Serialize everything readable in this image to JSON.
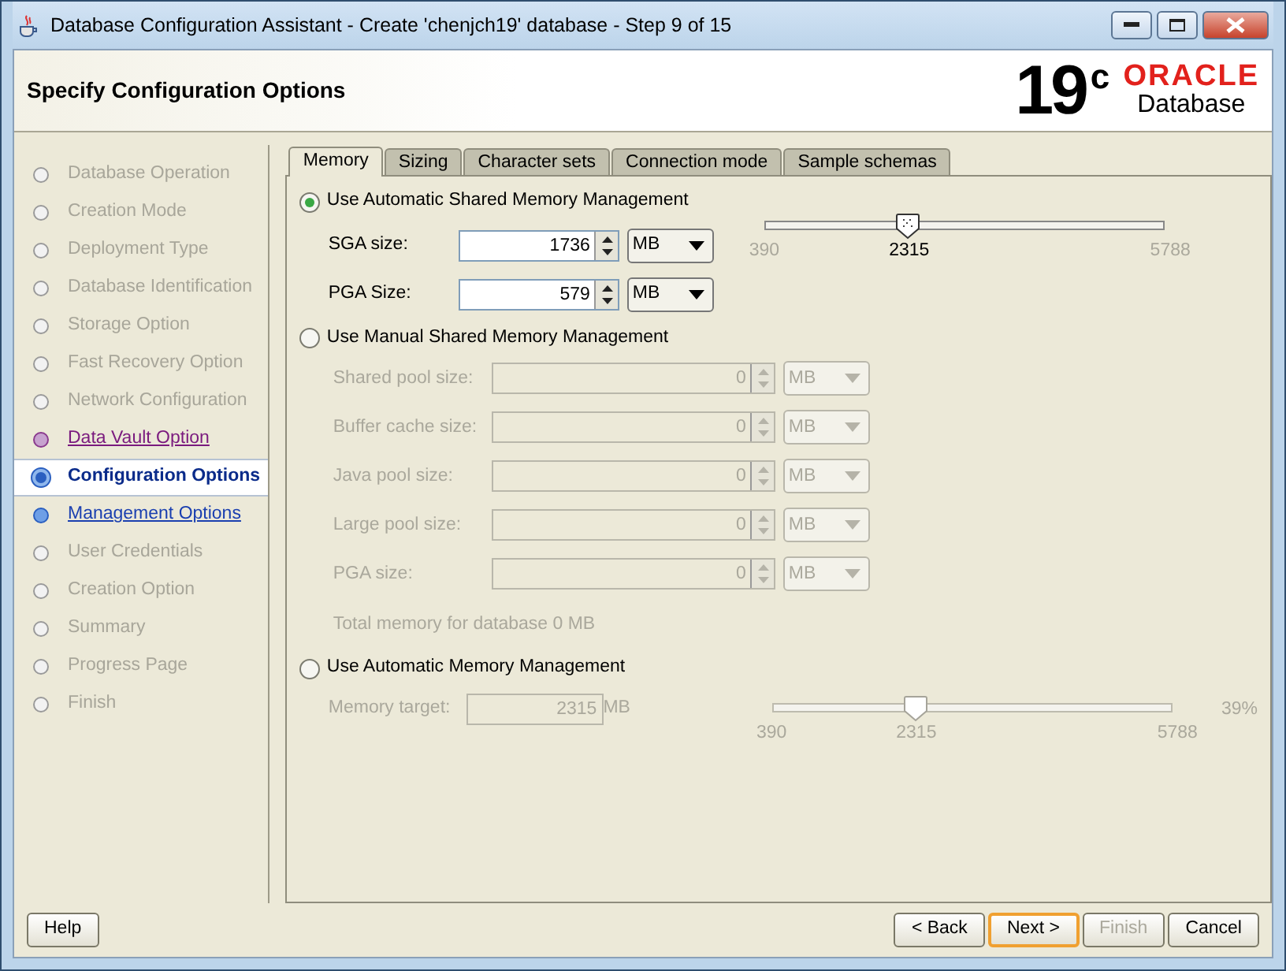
{
  "window": {
    "title": "Database Configuration Assistant - Create 'chenjch19' database - Step 9 of 15"
  },
  "header": {
    "title": "Specify Configuration Options",
    "logo_version": "19",
    "logo_superscript": "c",
    "logo_brand": "ORACLE",
    "logo_product": "Database"
  },
  "steps": [
    {
      "label": "Database Operation",
      "kind": "disabled",
      "selected": false
    },
    {
      "label": "Creation Mode",
      "kind": "disabled",
      "selected": false
    },
    {
      "label": "Deployment Type",
      "kind": "disabled",
      "selected": false
    },
    {
      "label": "Database Identification",
      "kind": "disabled",
      "selected": false
    },
    {
      "label": "Storage Option",
      "kind": "disabled",
      "selected": false
    },
    {
      "label": "Fast Recovery Option",
      "kind": "disabled",
      "selected": false
    },
    {
      "label": "Network Configuration",
      "kind": "disabled",
      "selected": false
    },
    {
      "label": "Data Vault Option",
      "kind": "visited",
      "selected": false
    },
    {
      "label": "Configuration Options",
      "kind": "current",
      "selected": true
    },
    {
      "label": "Management Options",
      "kind": "link",
      "selected": false
    },
    {
      "label": "User Credentials",
      "kind": "disabled",
      "selected": false
    },
    {
      "label": "Creation Option",
      "kind": "disabled",
      "selected": false
    },
    {
      "label": "Summary",
      "kind": "disabled",
      "selected": false
    },
    {
      "label": "Progress Page",
      "kind": "disabled",
      "selected": false
    },
    {
      "label": "Finish",
      "kind": "disabled",
      "selected": false
    }
  ],
  "tabs": [
    {
      "label": "Memory",
      "selected": true
    },
    {
      "label": "Sizing",
      "selected": false
    },
    {
      "label": "Character sets",
      "selected": false
    },
    {
      "label": "Connection mode",
      "selected": false
    },
    {
      "label": "Sample schemas",
      "selected": false
    }
  ],
  "memory_options": [
    {
      "label": "Use Automatic Shared Memory Management",
      "selected": true,
      "fields": [
        {
          "label": "SGA size:",
          "value": "1736",
          "unit": "MB",
          "disabled": false
        },
        {
          "label": "PGA Size:",
          "value": "579",
          "unit": "MB",
          "disabled": false
        }
      ],
      "slider": {
        "level": 0.357,
        "min": "390",
        "value": "2315",
        "max": "5788",
        "disabled": false
      }
    },
    {
      "label": "Use Manual Shared Memory Management",
      "selected": false,
      "fields": [
        {
          "label": "Shared pool size:",
          "value": "0",
          "unit": "MB",
          "disabled": true
        },
        {
          "label": "Buffer cache size:",
          "value": "0",
          "unit": "MB",
          "disabled": true
        },
        {
          "label": "Java pool size:",
          "value": "0",
          "unit": "MB",
          "disabled": true
        },
        {
          "label": "Large pool size:",
          "value": "0",
          "unit": "MB",
          "disabled": true
        },
        {
          "label": "PGA size:",
          "value": "0",
          "unit": "MB",
          "disabled": true
        }
      ],
      "note": "Total memory for database 0 MB"
    },
    {
      "label": "Use Automatic Memory Management",
      "selected": false,
      "target": {
        "label": "Memory target:",
        "value": "2315",
        "unit": "MB",
        "disabled": true
      },
      "slider": {
        "level": 0.357,
        "min": "390",
        "value": "2315",
        "max": "5788",
        "percent": "39%",
        "disabled": true
      }
    }
  ],
  "buttons": [
    {
      "label": "Help",
      "disabled": false,
      "focused": false
    },
    {
      "label": "< Back",
      "disabled": false,
      "focused": false
    },
    {
      "label": "Next >",
      "disabled": false,
      "focused": true
    },
    {
      "label": "Finish",
      "disabled": true,
      "focused": false
    },
    {
      "label": "Cancel",
      "disabled": false,
      "focused": false
    }
  ]
}
